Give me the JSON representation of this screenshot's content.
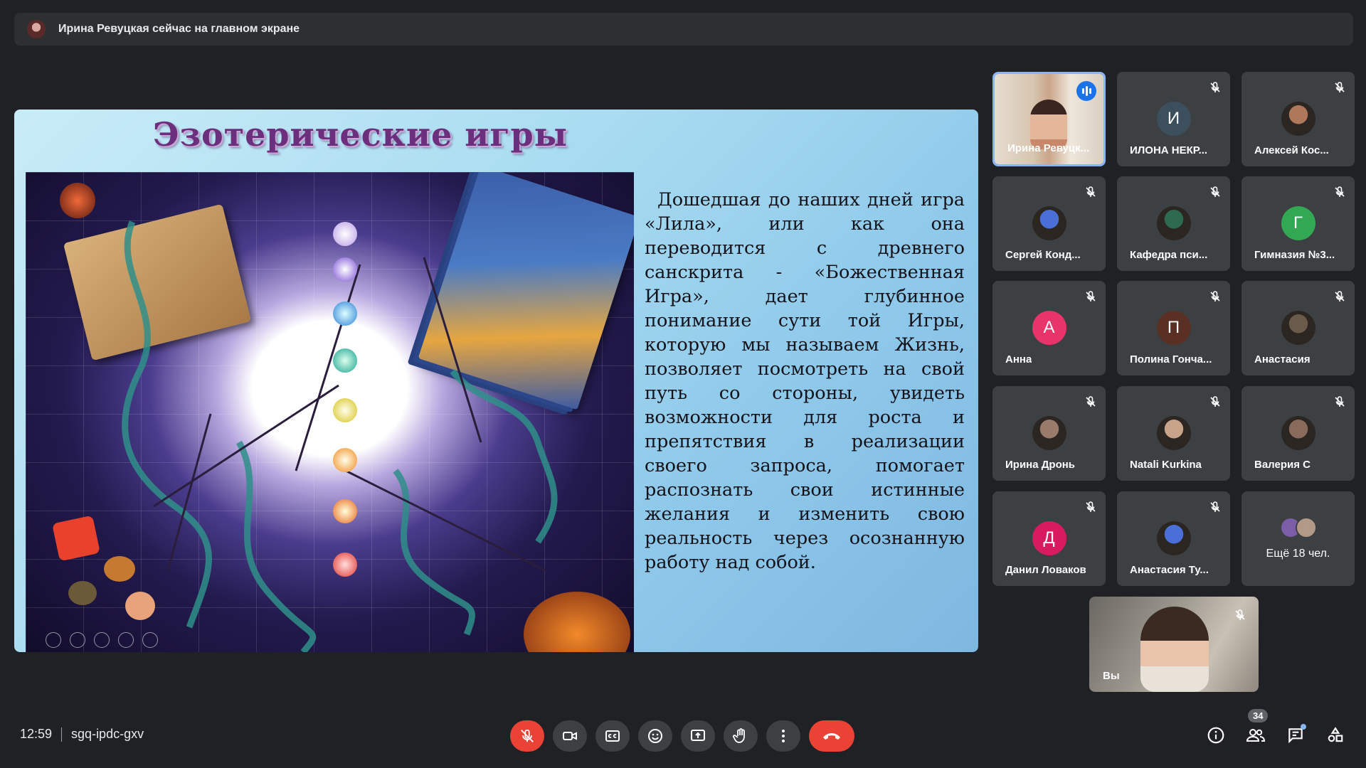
{
  "banner": {
    "text": "Ирина Ревуцкая сейчас на главном экране",
    "avatar_icon": "presenter-avatar"
  },
  "slide": {
    "title": "Эзотерические игры",
    "body": "Дошедшая до наших дней игра «Лила», или как она переводится с древнего санскрита - «Божественная Игра», дает глубинное понимание сути той Игры, которую мы называем Жизнь, позволяет посмотреть на свой путь со стороны, увидеть возможности для роста и препятствия в реализации своего запроса, помогает распознать свои истинные желания и изменить свою реальность через осознанную работу над собой."
  },
  "participants": [
    {
      "name": "Ирина Ревуцк...",
      "speaking": true
    },
    {
      "name": "ИЛОНА НЕКР...",
      "initial": "И",
      "color": "#3c4f5c"
    },
    {
      "name": "Алексей Кос..."
    },
    {
      "name": "Сергей Конд..."
    },
    {
      "name": "Кафедра пси..."
    },
    {
      "name": "Гимназия №3...",
      "initial": "Г",
      "color": "#33a852"
    },
    {
      "name": "Анна",
      "initial": "А",
      "color": "#e8336b"
    },
    {
      "name": "Полина Гонча...",
      "initial": "П",
      "color": "#5a3025"
    },
    {
      "name": "Анастасия"
    },
    {
      "name": "Ирина Дронь"
    },
    {
      "name": "Natali Kurkina"
    },
    {
      "name": "Валерия С"
    },
    {
      "name": "Данил Ловаков",
      "initial": "Д",
      "color": "#d81b60"
    },
    {
      "name": "Анастасия Ту..."
    }
  ],
  "more": {
    "label": "Ещё 18 чел."
  },
  "self": {
    "name": "Вы"
  },
  "meeting": {
    "time": "12:59",
    "code": "sgq-ipdc-gxv"
  },
  "people_count": "34",
  "colors": {
    "bg": "#202124",
    "tile": "#3c4043",
    "danger": "#ea4335",
    "accent": "#8ab4f8",
    "speaking": "#1a73e8"
  }
}
